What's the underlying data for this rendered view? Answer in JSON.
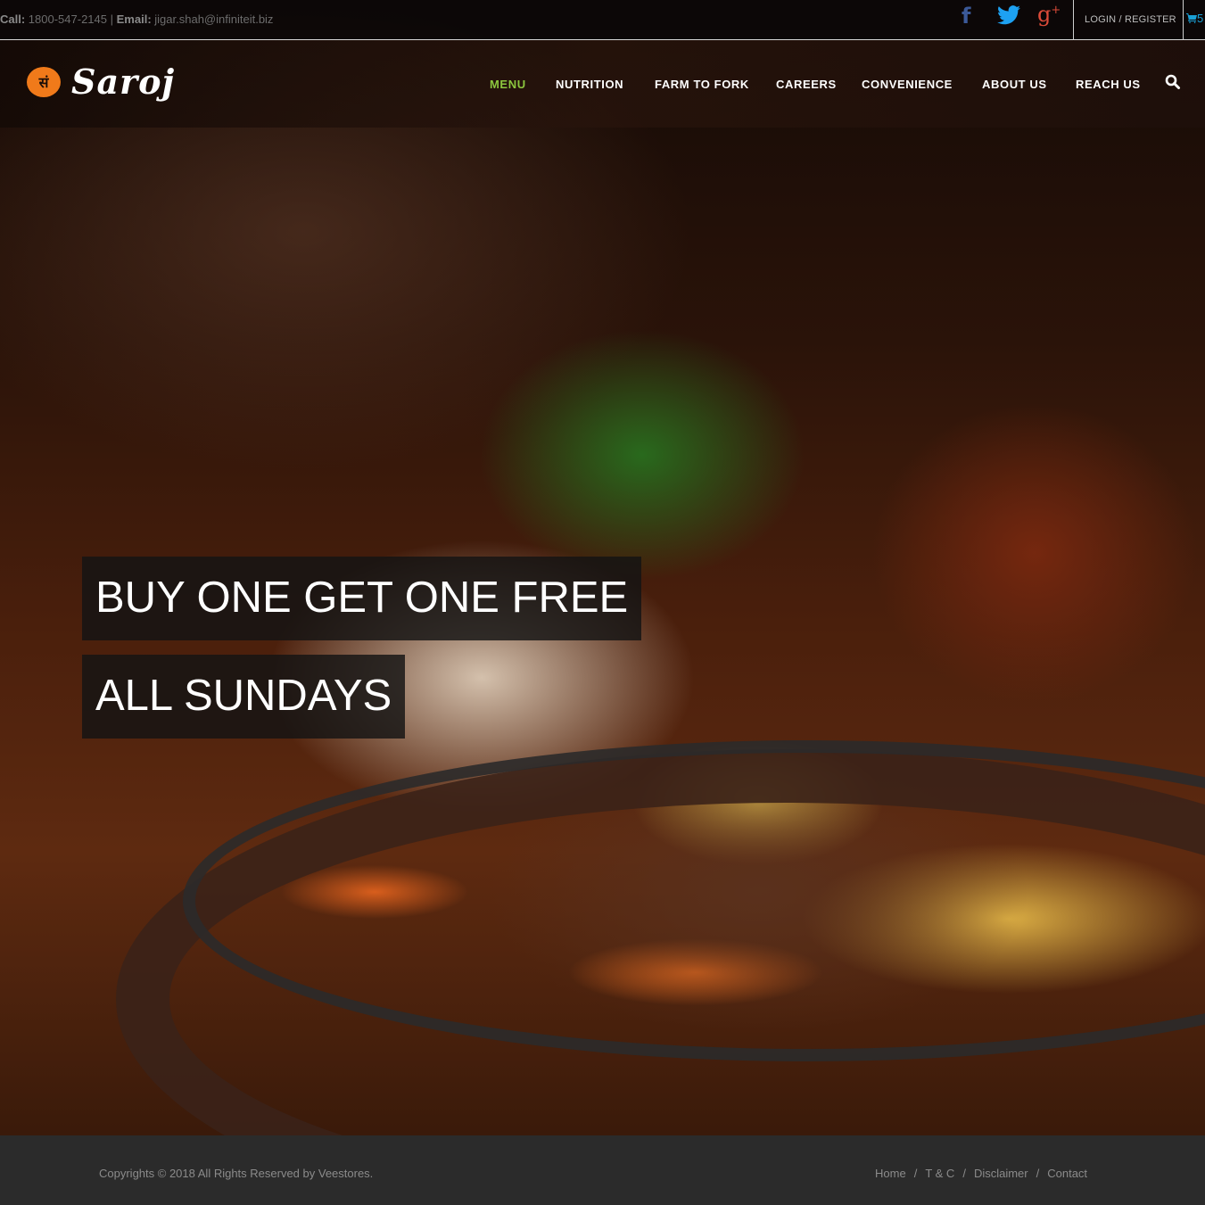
{
  "topbar": {
    "call_label": "Call:",
    "phone": "1800-547-2145",
    "separator": "|",
    "email_label": "Email:",
    "email": "jigar.shah@infiniteit.biz",
    "social": [
      {
        "name": "facebook-icon",
        "glyph": "f"
      },
      {
        "name": "twitter-icon",
        "glyph": ""
      },
      {
        "name": "google-plus-icon",
        "glyph": "g"
      }
    ],
    "google_plus_sup": "+",
    "login": "LOGIN / REGISTER",
    "cart_count": "5"
  },
  "nav": {
    "logo_text": "Saroj",
    "logo_emblem": "सं",
    "items": [
      "MENU",
      "NUTRITION",
      "FARM TO FORK",
      "CAREERS",
      "CONVENIENCE",
      "ABOUT US",
      "REACH US"
    ],
    "active": "MENU"
  },
  "hero": {
    "line1": "BUY ONE GET ONE FREE",
    "line2": "ALL SUNDAYS"
  },
  "footer": {
    "copyright": "Copyrights © 2018 All Rights Reserved by Veestores.",
    "links": [
      "Home",
      "T & C",
      "Disclaimer",
      "Contact"
    ],
    "link_separator": "/"
  },
  "colors": {
    "accent_green": "#8cc63e",
    "facebook": "#3b5998",
    "twitter": "#1da1f2",
    "google_plus": "#dd4b39",
    "cart": "#1a9fd4",
    "footer_bg": "#2b2b2b"
  }
}
